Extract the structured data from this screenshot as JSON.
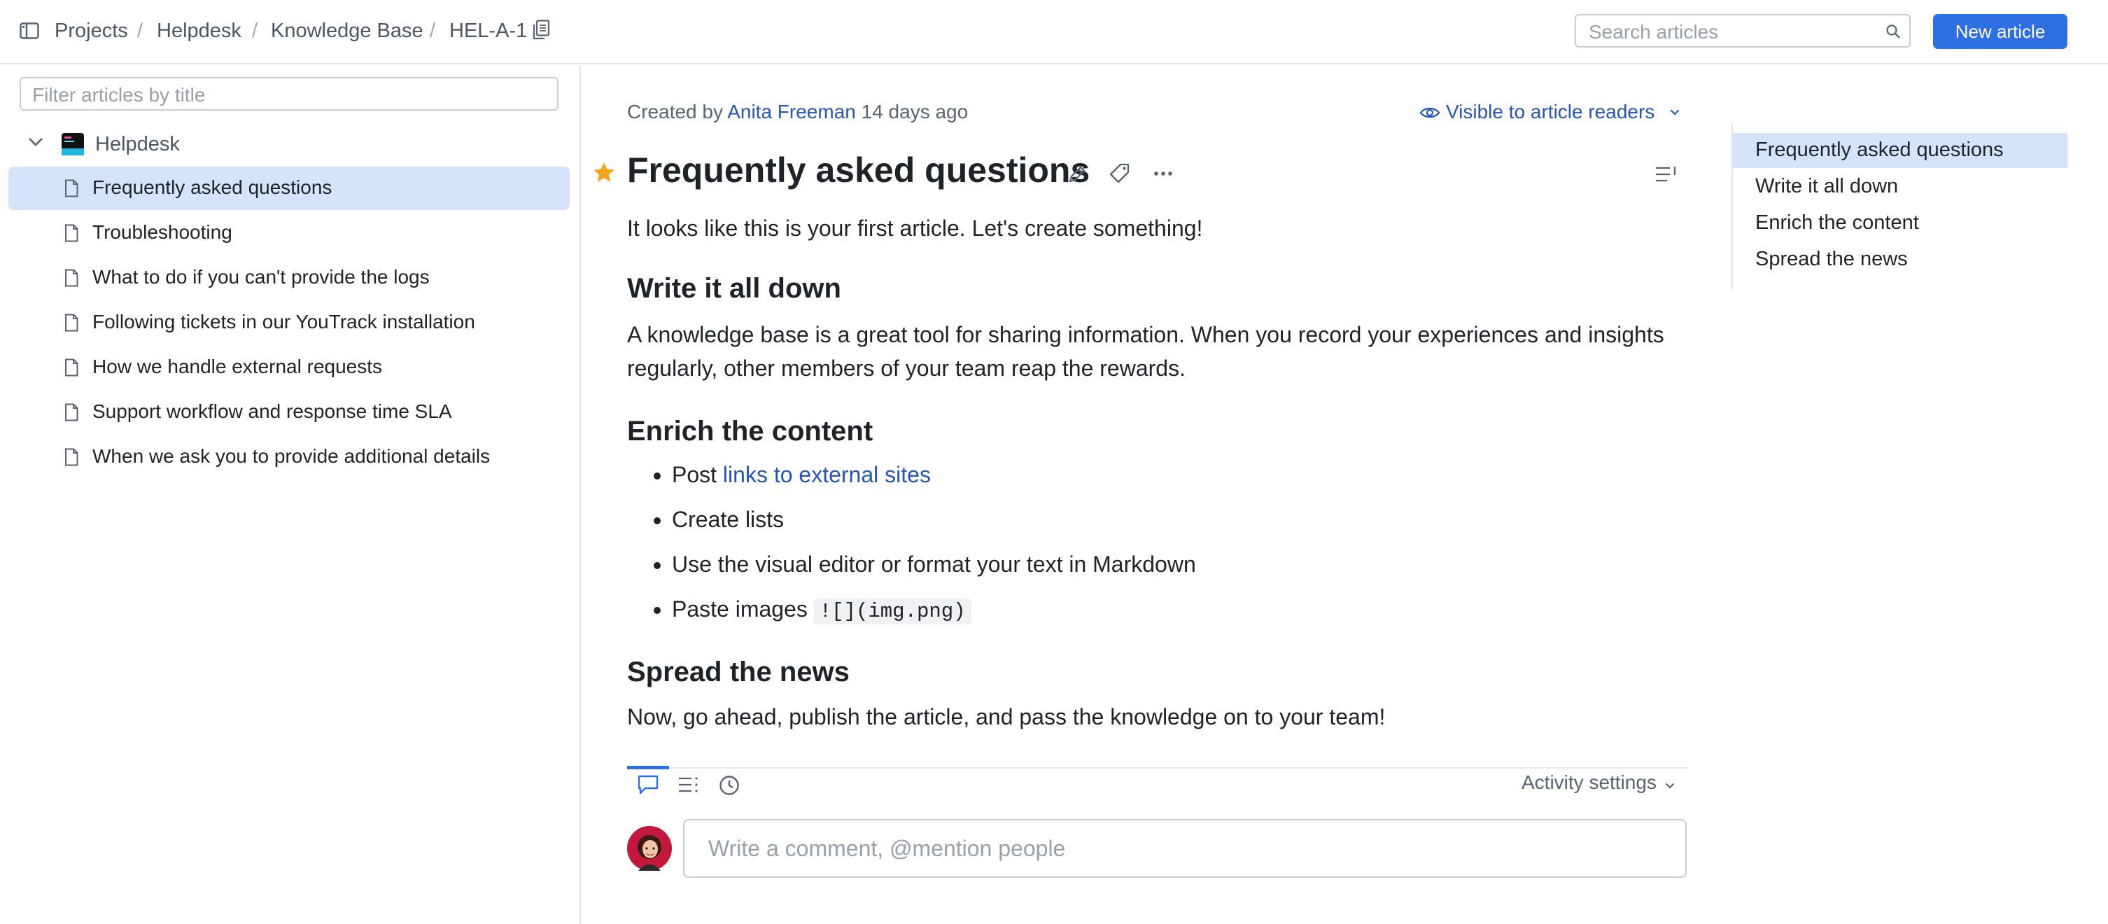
{
  "breadcrumb": {
    "items": [
      "Projects",
      "Helpdesk",
      "Knowledge Base",
      "HEL-A-1"
    ],
    "separator": "/"
  },
  "header": {
    "search_placeholder": "Search articles",
    "new_article_label": "New article"
  },
  "sidebar": {
    "filter_placeholder": "Filter articles by title",
    "project": "Helpdesk",
    "items": [
      {
        "label": "Frequently asked questions",
        "selected": true
      },
      {
        "label": "Troubleshooting",
        "selected": false
      },
      {
        "label": "What to do if you can't provide the logs",
        "selected": false
      },
      {
        "label": "Following tickets in our YouTrack installation",
        "selected": false
      },
      {
        "label": "How we handle external requests",
        "selected": false
      },
      {
        "label": "Support workflow and response time SLA",
        "selected": false
      },
      {
        "label": "When we ask you to provide additional details",
        "selected": false
      }
    ]
  },
  "article": {
    "created_prefix": "Created by",
    "author": "Anita Freeman",
    "created_ago": "14 days ago",
    "visibility": "Visible to article readers",
    "title": "Frequently asked questions",
    "intro": "It looks like this is your first article. Let's create something!",
    "sections": [
      {
        "heading": "Write it all down",
        "text_line1": "A knowledge base is a great tool for sharing information. When you record your experiences and insights",
        "text_line2": "regularly, other members of your team reap the rewards."
      },
      {
        "heading": "Enrich the content",
        "bullets": {
          "post_prefix": "Post",
          "post_link": "links to external sites",
          "create_lists": "Create lists",
          "visual_editor": "Use the visual editor or format your text in Markdown",
          "paste_prefix": "Paste images",
          "paste_code": "![](img.png)"
        }
      },
      {
        "heading": "Spread the news",
        "text": "Now, go ahead, publish the article, and pass the knowledge on to your team!"
      }
    ]
  },
  "toc": {
    "items": [
      {
        "label": "Frequently asked questions",
        "selected": true
      },
      {
        "label": "Write it all down",
        "selected": false
      },
      {
        "label": "Enrich the content",
        "selected": false
      },
      {
        "label": "Spread the news",
        "selected": false
      }
    ]
  },
  "activity": {
    "settings_label": "Activity settings",
    "comment_placeholder": "Write a comment, @mention people"
  },
  "colors": {
    "accent": "#2f6fe4",
    "link": "#2456b8",
    "selection": "#d6e4fb",
    "star": "#f4a41c"
  }
}
